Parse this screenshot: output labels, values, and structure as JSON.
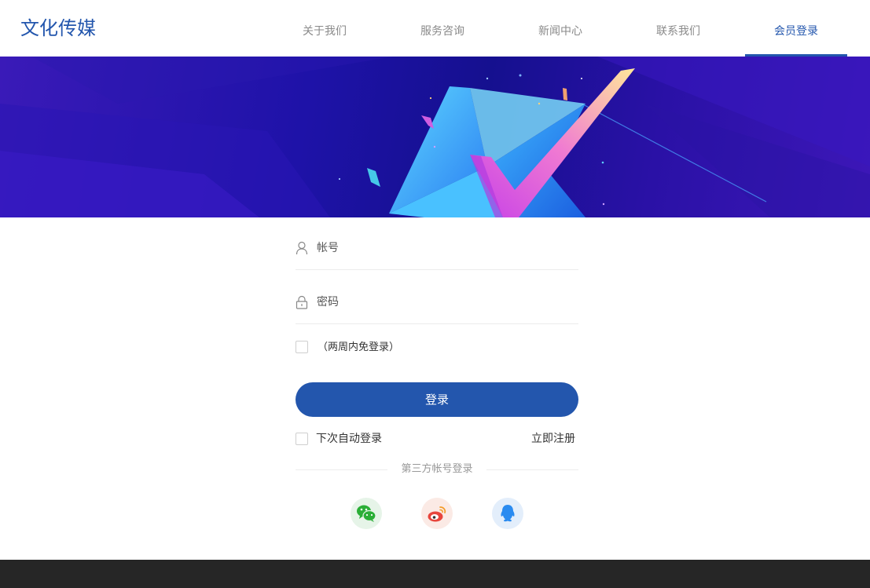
{
  "brand": {
    "logo_text": "文化传媒",
    "accent_color": "#2356ad"
  },
  "nav": {
    "items": [
      {
        "label": "关于我们",
        "active": false
      },
      {
        "label": "服务咨询",
        "active": false
      },
      {
        "label": "新闻中心",
        "active": false
      },
      {
        "label": "联系我们",
        "active": false
      },
      {
        "label": "会员登录",
        "active": true
      }
    ]
  },
  "login": {
    "account_placeholder": "帐号",
    "account_icon": "user-icon",
    "password_placeholder": "密码",
    "password_icon": "lock-icon",
    "remember_label": "（两周内免登录）",
    "submit_label": "登录",
    "auto_login_label": "下次自动登录",
    "register_label": "立即注册",
    "third_party_label": "第三方帐号登录",
    "social": [
      {
        "icon": "wechat-icon",
        "color": "#2aae36"
      },
      {
        "icon": "weibo-icon",
        "color": "#e8453c"
      },
      {
        "icon": "qq-icon",
        "color": "#2a8bf0"
      }
    ]
  },
  "footer": {
    "color": "#262626"
  }
}
